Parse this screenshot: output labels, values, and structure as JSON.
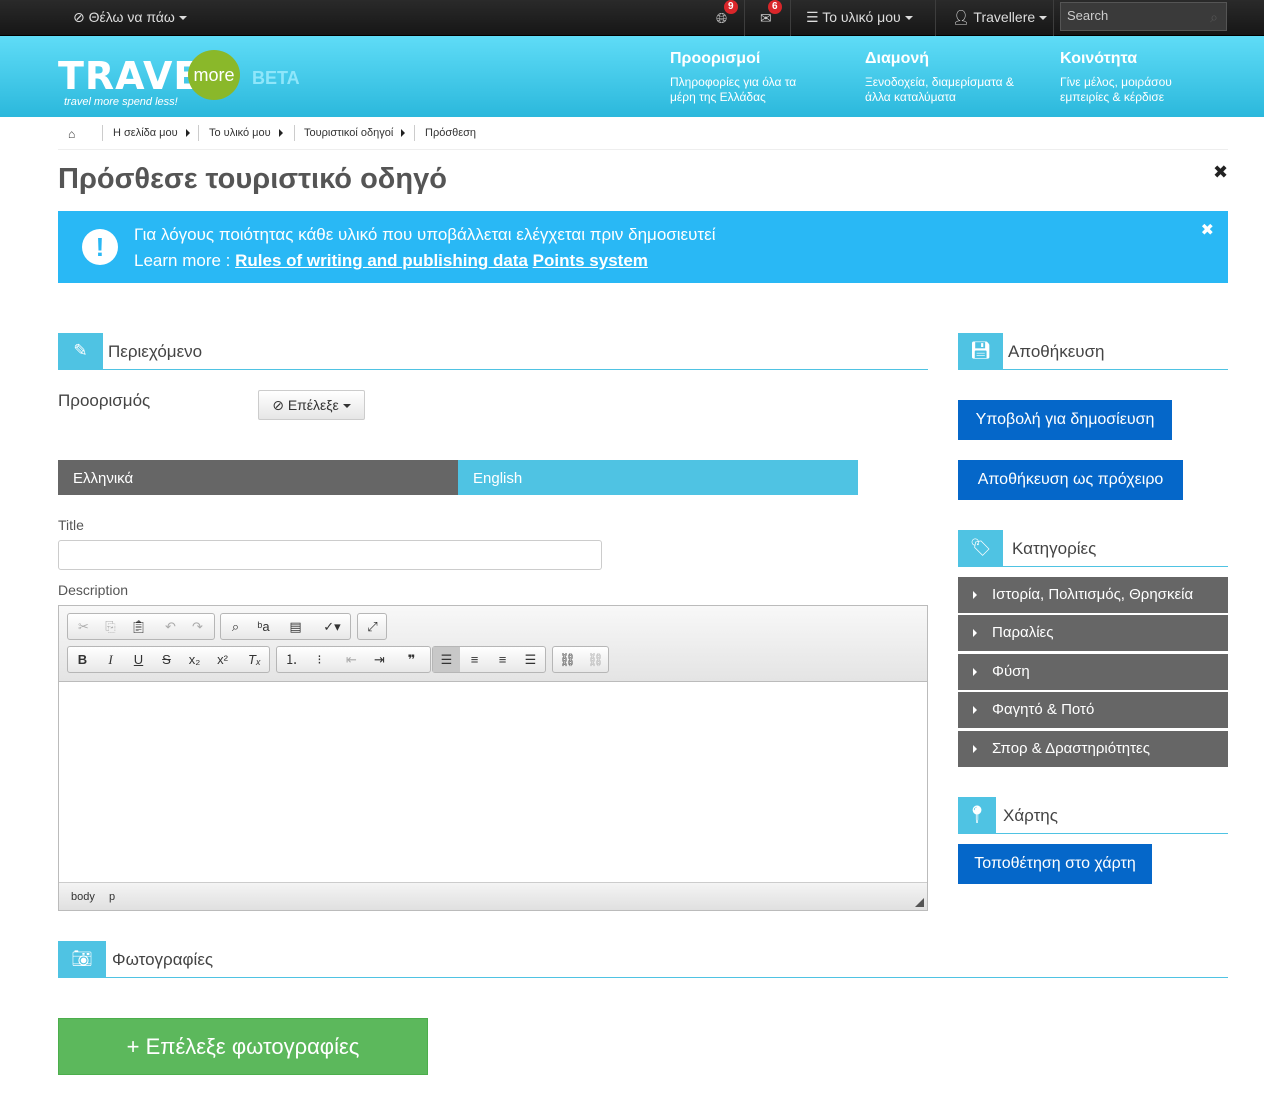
{
  "topbar": {
    "where_label": "Θέλω να πάω",
    "notif_badge": "9",
    "mail_badge": "6",
    "my_content": "Το υλικό μου",
    "user": "Travellere",
    "search_placeholder": "Search"
  },
  "header": {
    "logo_travel": "TRAVEL",
    "logo_more": "more",
    "logo_beta": "BETA",
    "tagline": "travel more spend less!",
    "nav": [
      {
        "title": "Προορισμοί",
        "sub": "Πληροφορίες για όλα τα μέρη της Ελλάδας"
      },
      {
        "title": "Διαμονή",
        "sub": "Ξενοδοχεία, διαμερίσματα & άλλα καταλύματα"
      },
      {
        "title": "Κοινότητα",
        "sub": "Γίνε μέλος, μοιράσου εμπειρίες & κέρδισε"
      }
    ]
  },
  "breadcrumb": [
    "Η σελίδα μου",
    "Το υλικό μου",
    "Τουριστικοί οδηγοί",
    "Πρόσθεση"
  ],
  "page_title": "Πρόσθεσε τουριστικό οδηγό",
  "alert": {
    "line1": "Για λόγους ποιότητας κάθε υλικό που υποβάλλεται ελέγχεται πριν δημοσιευτεί",
    "learn_more": "Learn more :",
    "link1": "Rules of writing and publishing data",
    "link2": "Points system"
  },
  "content_section": {
    "title": "Περιεχόμενο",
    "destination_label": "Προορισμός",
    "destination_button": "Επέλεξε",
    "tabs": [
      "Ελληνικά",
      "English"
    ],
    "title_label": "Title",
    "description_label": "Description",
    "editor_path": [
      "body",
      "p"
    ]
  },
  "save_section": {
    "title": "Αποθήκευση",
    "submit": "Υποβολή για δημοσίευση",
    "draft": "Αποθήκευση ως πρόχειρο"
  },
  "categories_section": {
    "title": "Κατηγορίες",
    "items": [
      "Ιστορία, Πολιτισμός, Θρησκεία",
      "Παραλίες",
      "Φύση",
      "Φαγητό & Ποτό",
      "Σπορ & Δραστηριότητες"
    ]
  },
  "map_section": {
    "title": "Χάρτης",
    "button": "Τοποθέτηση στο χάρτη"
  },
  "photos_section": {
    "title": "Φωτογραφίες",
    "button": "+ Επέλεξε φωτογραφίες"
  },
  "colors": {
    "accent": "#4fc3e3",
    "alert": "#29b8f5",
    "primary_button": "#0567c9",
    "success": "#5cb85c"
  }
}
